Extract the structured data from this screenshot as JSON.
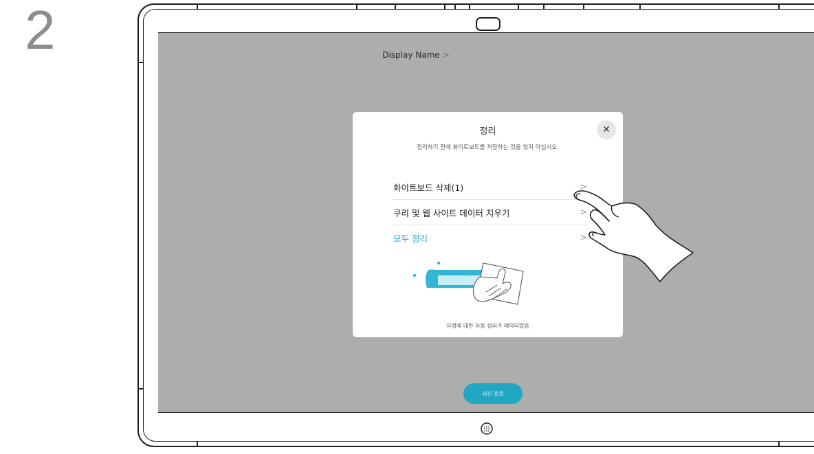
{
  "step": {
    "number": "2"
  },
  "screen": {
    "display_name": "Display Name",
    "display_name_chevron": ">"
  },
  "dialog": {
    "title": "정리",
    "close_icon": "close-icon",
    "subtitle": "정리하기 전에 화이트보드를 저장하는 것을 잊지 마십시오.",
    "items": [
      {
        "label": "화이트보드 삭제(1)",
        "chevron": ">"
      },
      {
        "label": "쿠리 및 웹 사이트 데이터 지우기",
        "chevron": ">"
      },
      {
        "label": "모두 정리",
        "chevron": ">"
      }
    ],
    "footer": "자정에 대한 자동 정리가 예약되었음"
  },
  "end_session_button": {
    "label": "세션 종료"
  },
  "colors": {
    "screen_bg": "#adadad",
    "accent": "#1e9fc8",
    "button": "#21a7c2"
  }
}
